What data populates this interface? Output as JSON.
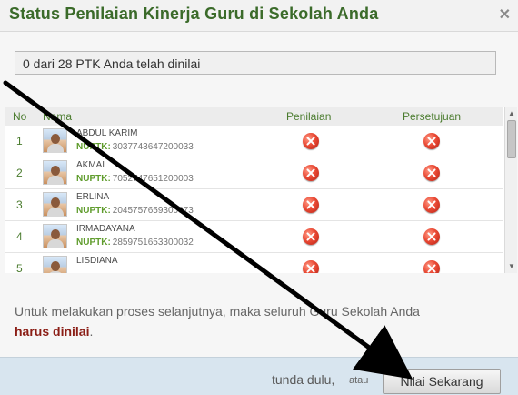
{
  "dialog": {
    "title": "Status Penilaian Kinerja Guru di Sekolah Anda",
    "close_icon": "close-icon"
  },
  "status": {
    "text": "0 dari 28 PTK Anda telah dinilai"
  },
  "table": {
    "headers": {
      "no": "No",
      "name": "Nama",
      "assessment": "Penilaian",
      "approval": "Persetujuan"
    },
    "rows": [
      {
        "no": "1",
        "name": "ABDUL KARIM",
        "nuptk_label": "NUPTK:",
        "nuptk": "3037743647200033",
        "assessment_icon": "cross-icon",
        "approval_icon": "cross-icon"
      },
      {
        "no": "2",
        "name": "AKMAL",
        "nuptk_label": "NUPTK:",
        "nuptk": "7052747651200003",
        "assessment_icon": "cross-icon",
        "approval_icon": "cross-icon"
      },
      {
        "no": "3",
        "name": "ERLINA",
        "nuptk_label": "NUPTK:",
        "nuptk": "2045757659300073",
        "assessment_icon": "cross-icon",
        "approval_icon": "cross-icon"
      },
      {
        "no": "4",
        "name": "IRMADAYANA",
        "nuptk_label": "NUPTK:",
        "nuptk": "2859751653300032",
        "assessment_icon": "cross-icon",
        "approval_icon": "cross-icon"
      },
      {
        "no": "5",
        "name": "LISDIANA",
        "nuptk_label": "",
        "nuptk": "",
        "assessment_icon": "cross-icon",
        "approval_icon": "cross-icon"
      }
    ]
  },
  "message": {
    "prefix": "Untuk melakukan proses selanjutnya, maka seluruh Guru Sekolah Anda",
    "emphasis": "harus dinilai",
    "suffix": "."
  },
  "footer": {
    "delay_text": "tunda dulu,",
    "or_text": "atau",
    "primary_button": "Nilai Sekarang"
  },
  "colors": {
    "title": "#3b6b2a",
    "accent_green": "#5f9c2c",
    "emphasis_red": "#8b1e16",
    "footer_bg": "#d8e5ef",
    "annotation_arrow": "#000000"
  }
}
